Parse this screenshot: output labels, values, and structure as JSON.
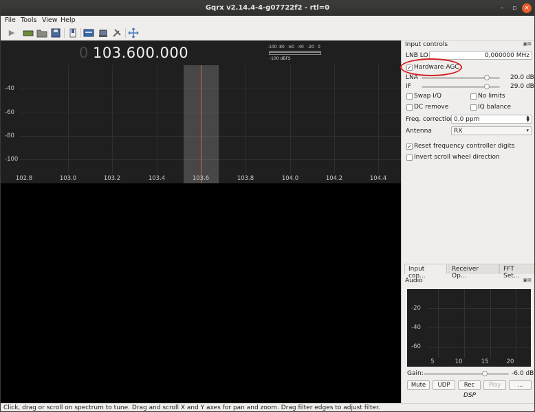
{
  "window": {
    "title": "Gqrx v2.14.4-4-g07722f2 - rtl=0"
  },
  "menu": [
    "File",
    "Tools",
    "View",
    "Help"
  ],
  "freq_ctrl": {
    "leading_zero": "0",
    "value": "103.600.000"
  },
  "meter": {
    "ticks": [
      "-100",
      "-80",
      "-60",
      "-40",
      "-20",
      "0"
    ],
    "label": "-100 dBFS"
  },
  "plot": {
    "y_labels": [
      "-40",
      "-60",
      "-80",
      "-100"
    ],
    "x_labels": [
      "102.8",
      "103.0",
      "103.2",
      "103.4",
      "103.6",
      "103.8",
      "104.0",
      "104.2",
      "104.4"
    ]
  },
  "input_controls": {
    "title": "Input controls",
    "lnb_label": "LNB LO",
    "lnb_value": "0,000000 MHz",
    "hw_agc_label": "Hardware AGC",
    "lna_label": "LNA",
    "lna_value": "20.0 dB",
    "lna_level": 0.83,
    "if_label": "IF",
    "if_value": "29.0 dB",
    "if_level": 0.83,
    "swap_iq": "Swap I/Q",
    "no_limits": "No limits",
    "dc_remove": "DC remove",
    "iq_balance": "IQ balance",
    "freq_corr_label": "Freq. correction",
    "freq_corr_value": "0,0 ppm",
    "antenna_label": "Antenna",
    "antenna_value": "RX",
    "reset_freq": "Reset frequency controller digits",
    "invert_scroll": "Invert scroll wheel direction"
  },
  "tabs": [
    "Input con...",
    "Receiver Op...",
    "FFT Set..."
  ],
  "audio": {
    "title": "Audio",
    "y_labels": [
      "-20",
      "-40",
      "-60"
    ],
    "x_labels": [
      "5",
      "10",
      "15",
      "20"
    ],
    "gain_label": "Gain:",
    "gain_value": "-6.0 dB",
    "gain_level": 0.72,
    "buttons": [
      "Mute",
      "UDP",
      "Rec",
      "Play",
      "..."
    ],
    "dsp_label": "DSP"
  },
  "status": {
    "text": "Click, drag or scroll on spectrum to tune. Drag and scroll X and Y axes for pan and zoom. Drag filter edges to adjust filter."
  },
  "colors": {
    "center_line": "#e06040",
    "annotation": "#d42020"
  }
}
